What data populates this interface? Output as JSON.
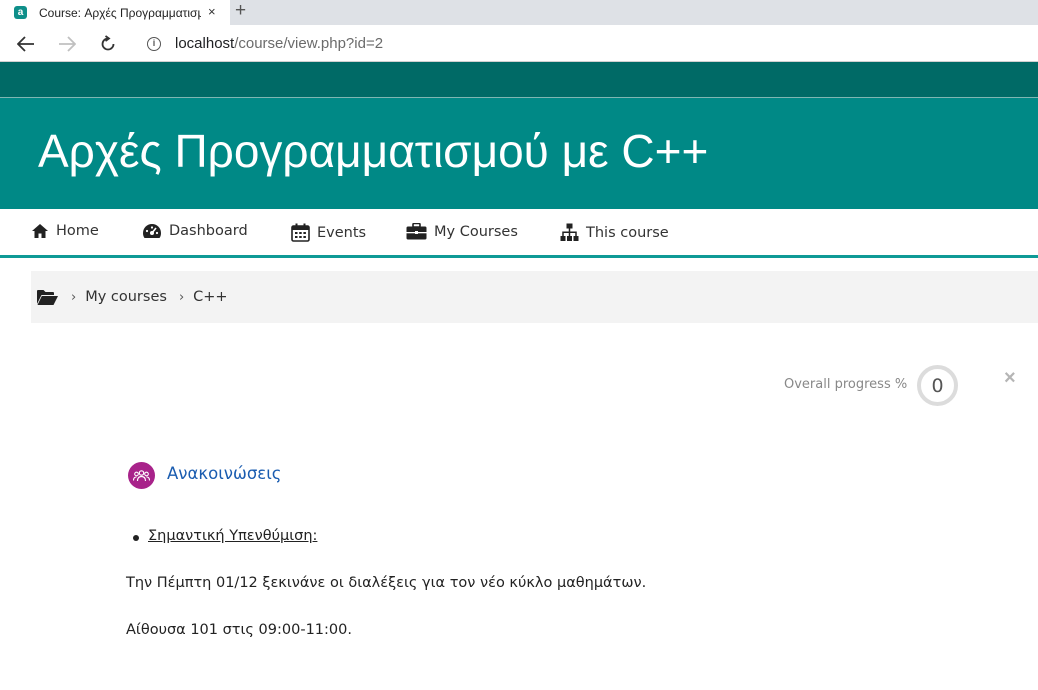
{
  "browser": {
    "tab_title": "Course: Αρχές Προγραμματισμού",
    "tab_close": "×",
    "new_tab": "+",
    "url_host": "localhost",
    "url_path": "/course/view.php?id=2",
    "info_icon": "i",
    "favicon": "a"
  },
  "course": {
    "title": "Αρχές Προγραμματισμού με C++"
  },
  "nav": {
    "items": [
      {
        "label": "Home",
        "icon": "home-icon"
      },
      {
        "label": "Dashboard",
        "icon": "dashboard-icon"
      },
      {
        "label": "Events",
        "icon": "calendar-icon"
      },
      {
        "label": "My Courses",
        "icon": "briefcase-icon"
      },
      {
        "label": "This course",
        "icon": "sitemap-icon"
      }
    ]
  },
  "breadcrumb": {
    "items": [
      "My courses",
      "C++"
    ],
    "separator": "›"
  },
  "progress": {
    "label": "Overall progress %",
    "value": "0",
    "close": "×"
  },
  "forum": {
    "title": "Ανακοινώσεις",
    "icon": "forum-icon"
  },
  "post": {
    "title": "Σημαντική Υπενθύμιση:",
    "paragraphs": [
      "Την Πέμπτη 01/12 ξεκινάνε οι διαλέξεις για τον νέο κύκλο μαθημάτων.",
      "Αίθουσα 101 στις 09:00-11:00."
    ]
  },
  "colors": {
    "header": "#008986",
    "topband": "#006a66",
    "nav_underline": "#0e9a96",
    "forum_icon": "#a8238a",
    "link": "#1a5cb0"
  }
}
